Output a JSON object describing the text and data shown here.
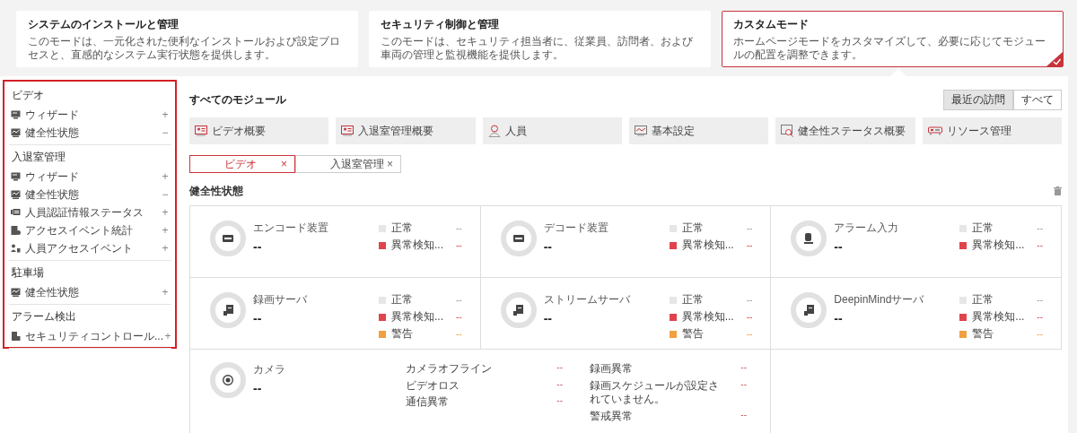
{
  "modes": [
    {
      "title": "システムのインストールと管理",
      "description": "このモードは、一元化された便利なインストールおよび設定プロセスと、直感的なシステム実行状態を提供します。",
      "selected": false
    },
    {
      "title": "セキュリティ制御と管理",
      "description": "このモードは、セキュリティ担当者に、従業員、訪問者、および車両の管理と監視機能を提供します。",
      "selected": false
    },
    {
      "title": "カスタムモード",
      "description": "ホームページモードをカスタマイズして、必要に応じてモジュールの配置を調整できます。",
      "selected": true
    }
  ],
  "sidebar": {
    "groups": [
      {
        "title": "ビデオ",
        "items": [
          {
            "kind": "wizard",
            "label": "ウィザード",
            "action": "+"
          },
          {
            "kind": "health",
            "label": "健全性状態",
            "action": "−"
          }
        ]
      },
      {
        "title": "入退室管理",
        "items": [
          {
            "kind": "wizard",
            "label": "ウィザード",
            "action": "+"
          },
          {
            "kind": "health",
            "label": "健全性状態",
            "action": "−"
          },
          {
            "kind": "credential",
            "label": "人員認証情報ステータス",
            "action": "+"
          },
          {
            "kind": "stats",
            "label": "アクセスイベント統計",
            "action": "+"
          },
          {
            "kind": "people",
            "label": "人員アクセスイベント",
            "action": "+"
          }
        ]
      },
      {
        "title": "駐車場",
        "items": [
          {
            "kind": "health",
            "label": "健全性状態",
            "action": "+"
          }
        ]
      },
      {
        "title": "アラーム検出",
        "items": [
          {
            "kind": "security",
            "label": "セキュリティコントロール...",
            "action": "+"
          }
        ]
      }
    ]
  },
  "main": {
    "title": "すべてのモジュール",
    "view_toggle": [
      {
        "label": "最近の訪問",
        "selected": true
      },
      {
        "label": "すべて",
        "selected": false
      }
    ],
    "modules": [
      {
        "kind": "card",
        "label": "ビデオ概要"
      },
      {
        "kind": "card",
        "label": "入退室管理概要"
      },
      {
        "kind": "person",
        "label": "人員"
      },
      {
        "kind": "chart",
        "label": "基本設定"
      },
      {
        "kind": "health",
        "label": "健全性ステータス概要"
      },
      {
        "kind": "device",
        "label": "リソース管理"
      }
    ],
    "filters": [
      {
        "label": "ビデオ",
        "close": "×",
        "selected": true
      },
      {
        "label": "入退室管理",
        "close": "×",
        "selected": false
      }
    ],
    "section_title": "健全性状態",
    "cards": [
      {
        "kind": "encoder",
        "title": "エンコード装置",
        "value": "--",
        "legend": [
          {
            "label": "正常",
            "value": "--",
            "color": "#e6e6e6"
          },
          {
            "label": "異常検知...",
            "value": "--",
            "color": "#e0434c"
          }
        ]
      },
      {
        "kind": "encoder",
        "title": "デコード装置",
        "value": "--",
        "legend": [
          {
            "label": "正常",
            "value": "--",
            "color": "#e6e6e6"
          },
          {
            "label": "異常検知...",
            "value": "--",
            "color": "#e0434c"
          }
        ]
      },
      {
        "kind": "alarm",
        "title": "アラーム入力",
        "value": "--",
        "legend": [
          {
            "label": "正常",
            "value": "--",
            "color": "#e6e6e6"
          },
          {
            "label": "異常検知...",
            "value": "--",
            "color": "#e0434c"
          }
        ]
      },
      {
        "kind": "server",
        "title": "録画サーバ",
        "value": "--",
        "legend": [
          {
            "label": "正常",
            "value": "--",
            "color": "#e6e6e6"
          },
          {
            "label": "異常検知...",
            "value": "--",
            "color": "#e0434c"
          },
          {
            "label": "警告",
            "value": "--",
            "color": "#f0a040"
          }
        ]
      },
      {
        "kind": "server",
        "title": "ストリームサーバ",
        "value": "--",
        "legend": [
          {
            "label": "正常",
            "value": "--",
            "color": "#e6e6e6"
          },
          {
            "label": "異常検知...",
            "value": "--",
            "color": "#e0434c"
          },
          {
            "label": "警告",
            "value": "--",
            "color": "#f0a040"
          }
        ]
      },
      {
        "kind": "server",
        "title": "DeepinMindサーバ",
        "value": "--",
        "legend": [
          {
            "label": "正常",
            "value": "--",
            "color": "#e6e6e6"
          },
          {
            "label": "異常検知...",
            "value": "--",
            "color": "#e0434c"
          },
          {
            "label": "警告",
            "value": "--",
            "color": "#f0a040"
          }
        ]
      },
      {
        "kind": "camera",
        "title": "カメラ",
        "value": "--",
        "columns": [
          [
            {
              "label": "カメラオフライン",
              "value": "--"
            },
            {
              "label": "ビデオロス",
              "value": "--"
            },
            {
              "label": "通信異常",
              "value": "--"
            }
          ],
          [
            {
              "label": "録画異常",
              "value": "--"
            },
            {
              "label": "録画スケジュールが設定されていません。",
              "value": "--"
            },
            {
              "label": "警戒異常",
              "value": "--"
            }
          ]
        ]
      }
    ]
  }
}
